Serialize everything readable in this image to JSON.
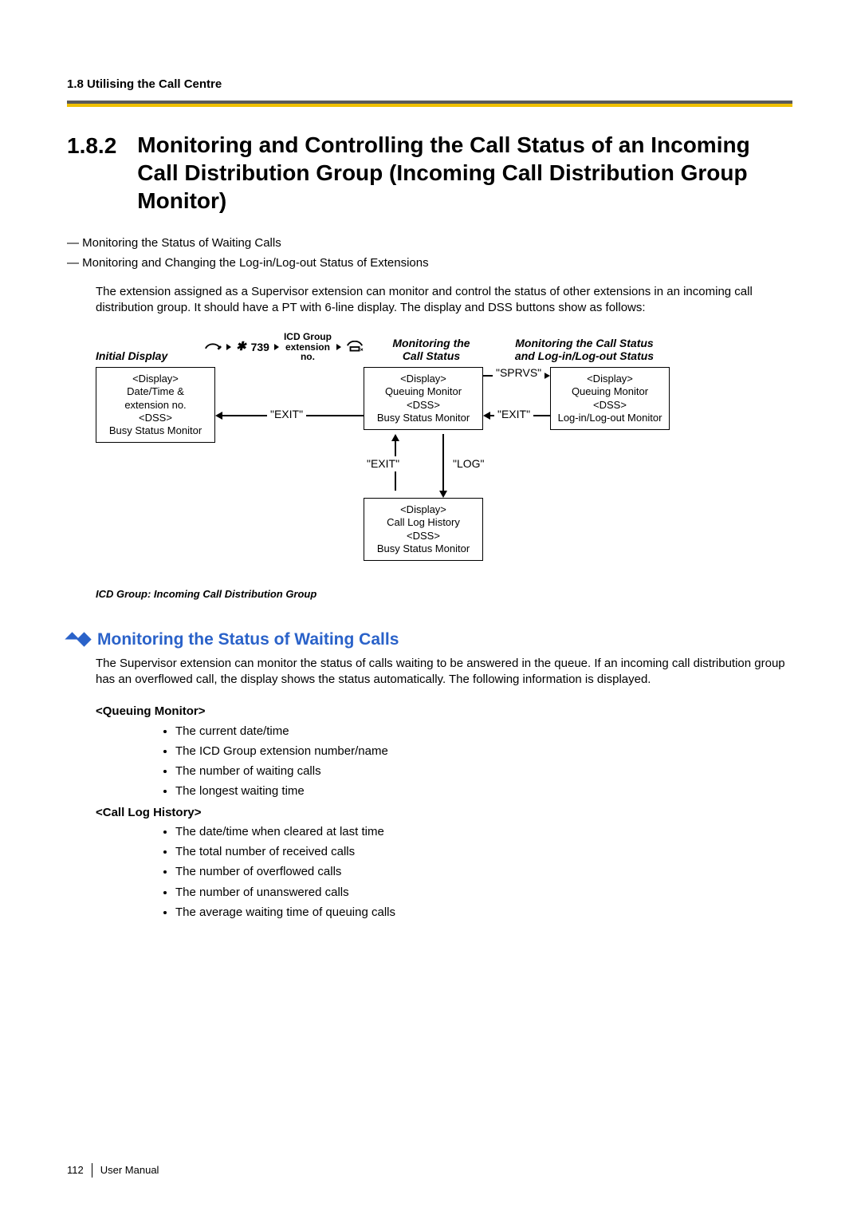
{
  "header": {
    "section": "1.8 Utilising the Call Centre"
  },
  "title": {
    "num": "1.8.2",
    "text": "Monitoring and Controlling the Call Status of an Incoming Call Distribution Group (Incoming Call Distribution Group Monitor)"
  },
  "intro_bullets": [
    "— Monitoring the Status of Waiting Calls",
    "— Monitoring and Changing the Log-in/Log-out Status of Extensions"
  ],
  "intro_para": "The extension assigned as a Supervisor extension can monitor and control the status of other extensions in an incoming call distribution group. It should have a PT with 6-line display. The display and DSS buttons show as follows:",
  "diagram": {
    "titles": {
      "initial": "Initial Display",
      "seq_num": "739",
      "seq_label": "ICD Group\nextension\nno.",
      "monitoring": "Monitoring the\nCall Status",
      "right": "Monitoring the Call Status\nand Log-in/Log-out Status"
    },
    "boxes": {
      "initial": "<Display>\nDate/Time &\nextension no.\n<DSS>\nBusy Status Monitor",
      "queue": "<Display>\nQueuing Monitor\n<DSS>\nBusy Status Monitor",
      "login": "<Display>\nQueuing Monitor\n<DSS>\nLog-in/Log-out Monitor",
      "calllog": "<Display>\nCall Log History\n<DSS>\nBusy Status Monitor"
    },
    "labels": {
      "exit": "\"EXIT\"",
      "sprvs": "\"SPRVS\"",
      "log": "\"LOG\""
    },
    "note": "ICD Group: Incoming Call Distribution Group"
  },
  "section2": {
    "title": "Monitoring the Status of Waiting Calls",
    "para": "The Supervisor extension can monitor the status of calls waiting to be answered in the queue. If an incoming call distribution group has an overflowed call, the display shows the status automatically. The following information is displayed.",
    "queuing_hdr": "<Queuing Monitor>",
    "queuing_items": [
      "The current date/time",
      "The ICD Group extension number/name",
      "The number of waiting calls",
      "The longest waiting time"
    ],
    "calllog_hdr": "<Call Log History>",
    "calllog_items": [
      "The date/time when cleared at last time",
      "The total number of received calls",
      "The number of overflowed calls",
      "The number of unanswered calls",
      "The average waiting time of queuing calls"
    ]
  },
  "footer": {
    "page": "112",
    "label": "User Manual"
  }
}
